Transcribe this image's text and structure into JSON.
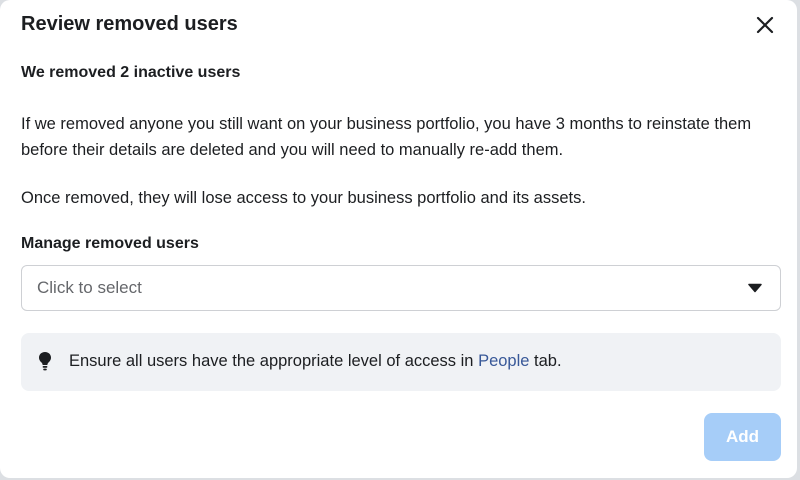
{
  "dialog": {
    "title": "Review removed users",
    "close_icon": "close-icon",
    "subheading": "We removed 2 inactive users",
    "paragraph_1": "If we removed anyone you still want on your business portfolio, you have 3 months to reinstate them before their details are deleted and you will need to manually re-add them.",
    "paragraph_2": "Once removed, they will lose access to your business portfolio and its assets.",
    "manage_label": "Manage removed users",
    "select": {
      "placeholder": "Click to select",
      "caret_icon": "caret-down-icon"
    },
    "notice": {
      "icon": "lightbulb-icon",
      "text_before": "Ensure all users have the appropriate level of access in ",
      "link_text": "People",
      "text_after": " tab."
    },
    "add_button": {
      "label": "Add",
      "state": "disabled"
    }
  },
  "colors": {
    "text": "#1c1e21",
    "muted": "#65676b",
    "link": "#385898",
    "button_disabled": "#a6cdf8",
    "notice_bg": "#f0f2f5"
  }
}
